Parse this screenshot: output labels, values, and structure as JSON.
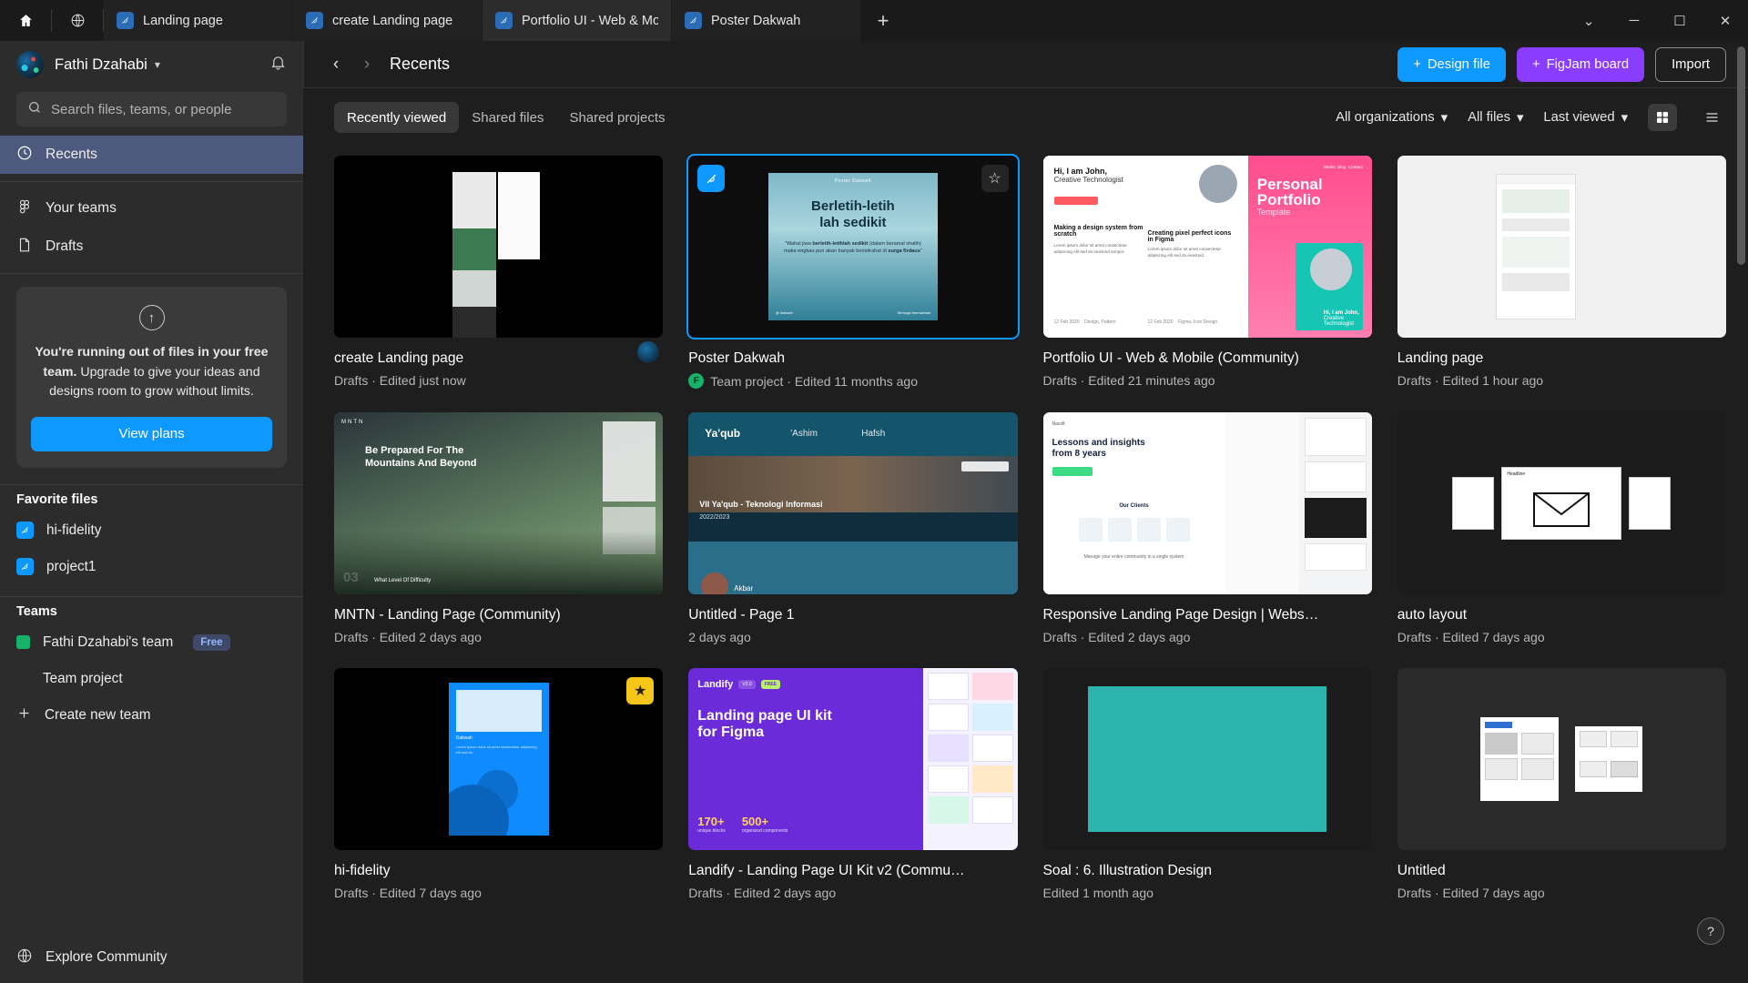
{
  "window": {
    "home_icon": "home-icon",
    "globe_icon": "globe-icon",
    "new_tab_label": "+",
    "minimize_label": "─",
    "maximize_label": "☐",
    "close_label": "✕",
    "menu_label": "⌄",
    "tabs": [
      {
        "label": "Landing page",
        "active": false
      },
      {
        "label": "create Landing page",
        "active": false
      },
      {
        "label": "Portfolio UI - Web & Mobile (Commun",
        "active": true
      },
      {
        "label": "Poster Dakwah",
        "active": false
      }
    ]
  },
  "sidebar": {
    "user_name": "Fathi Dzahabi",
    "search_placeholder": "Search files, teams, or people",
    "search_value": "",
    "nav": [
      {
        "label": "Recents",
        "icon": "clock-icon",
        "active": true
      },
      {
        "label": "Your teams",
        "icon": "figma-teams-icon",
        "active": false
      },
      {
        "label": "Drafts",
        "icon": "file-icon",
        "active": false
      }
    ],
    "upgrade": {
      "bold_text": "You're running out of files in your free team.",
      "rest_text": " Upgrade to give your ideas and designs room to grow without limits.",
      "button_label": "View plans"
    },
    "favorites_title": "Favorite files",
    "favorites": [
      {
        "label": "hi-fidelity"
      },
      {
        "label": "project1"
      }
    ],
    "teams_title": "Teams",
    "teams": [
      {
        "label": "Fathi Dzahabi's team",
        "badge": "Free",
        "swatch": "#17b26a"
      },
      {
        "label": "Team project",
        "badge": "",
        "swatch": ""
      }
    ],
    "create_team_label": "Create new team",
    "explore_label": "Explore Community"
  },
  "topbar": {
    "back_label": "‹",
    "forward_label": "›",
    "page_title": "Recents",
    "design_file_label": "Design file",
    "figjam_label": "FigJam board",
    "import_label": "Import"
  },
  "filterbar": {
    "tabs": [
      {
        "label": "Recently viewed",
        "active": true
      },
      {
        "label": "Shared files",
        "active": false
      },
      {
        "label": "Shared projects",
        "active": false
      }
    ],
    "org_filter": "All organizations",
    "files_filter": "All files",
    "sort_filter": "Last viewed",
    "grid_view": "grid-view-icon",
    "list_view": "list-view-icon"
  },
  "files": [
    {
      "title": "create Landing page",
      "meta": "Drafts · Edited just now",
      "selected": false,
      "starred": false,
      "project_dot": false,
      "avatar": true,
      "thumb": "create"
    },
    {
      "title": "Poster Dakwah",
      "meta": "Team project · Edited 11 months ago",
      "selected": true,
      "starred": true,
      "project_dot": true,
      "dot_letter": "F",
      "avatar": false,
      "thumb": "poster"
    },
    {
      "title": "Portfolio UI - Web & Mobile (Community)",
      "meta": "Drafts · Edited 21 minutes ago",
      "selected": false,
      "starred": false,
      "project_dot": false,
      "avatar": false,
      "thumb": "portfolio"
    },
    {
      "title": "Landing page",
      "meta": "Drafts · Edited 1 hour ago",
      "selected": false,
      "starred": false,
      "project_dot": false,
      "avatar": false,
      "thumb": "landing"
    },
    {
      "title": "MNTN - Landing Page (Community)",
      "meta": "Drafts · Edited 2 days ago",
      "selected": false,
      "starred": false,
      "project_dot": false,
      "avatar": false,
      "thumb": "mntn"
    },
    {
      "title": "Untitled - Page 1",
      "meta": "2 days ago",
      "selected": false,
      "starred": false,
      "project_dot": false,
      "avatar": false,
      "thumb": "yaqub"
    },
    {
      "title": "Responsive Landing Page Design | Websit…",
      "meta": "Drafts · Edited 2 days ago",
      "selected": false,
      "starred": false,
      "project_dot": false,
      "avatar": false,
      "thumb": "responsive"
    },
    {
      "title": "auto layout",
      "meta": "Drafts · Edited 7 days ago",
      "selected": false,
      "starred": false,
      "project_dot": false,
      "avatar": false,
      "thumb": "auto"
    },
    {
      "title": "hi-fidelity",
      "meta": "Drafts · Edited 7 days ago",
      "selected": false,
      "starred": true,
      "starred_gold": true,
      "project_dot": false,
      "avatar": false,
      "thumb": "hifi"
    },
    {
      "title": "Landify - Landing Page UI Kit v2 (Commu…",
      "meta": "Drafts · Edited 2 days ago",
      "selected": false,
      "starred": false,
      "project_dot": false,
      "avatar": false,
      "thumb": "landify"
    },
    {
      "title": "Soal : 6. Illustration Design",
      "meta": "Edited 1 month ago",
      "selected": false,
      "starred": false,
      "project_dot": false,
      "avatar": false,
      "thumb": "soal"
    },
    {
      "title": "Untitled",
      "meta": "Drafts · Edited 7 days ago",
      "selected": false,
      "starred": false,
      "project_dot": false,
      "avatar": false,
      "thumb": "untitled"
    }
  ],
  "thumb_text": {
    "poster_title": "Berletih-letih\nlah sedikit",
    "poster_sub": "\"Wahai jiwa berletih-letihlah sedikit (dalam beramal shalih) maka engkau pun akan banyak beristirahat di surga firdaus\"",
    "poster_top": "Poster Dakwah",
    "portfolio_hi": "Hi, I am John,",
    "portfolio_role": "Creative Technologist",
    "portfolio_big": "Personal",
    "portfolio_big2": "Portfolio",
    "portfolio_tmpl": "Template",
    "mntn_head": "Be Prepared For The Mountains And Beyond",
    "ya_names": "Ya'qub   'Ashim   Hafsh",
    "ya_sub": "VII Ya'qub - Teknologi Informasi",
    "ya_year": "2022/2023",
    "resp_head": "Lessons and insights from 8 years",
    "landify_name": "Landify",
    "landify_ver": "V2.0",
    "landify_free": "FREE",
    "landify_head": "Landing page UI kit for Figma",
    "landify_n1": "170+",
    "landify_n1s": "unique blocks",
    "landify_n2": "500+",
    "landify_n2s": "organized components"
  },
  "help_label": "?",
  "colors": {
    "accent_blue": "#0d99ff",
    "accent_purple": "#8b3dff",
    "active_nav": "#4d5a7d",
    "team_green": "#17b26a",
    "star_gold": "#f5c518"
  }
}
